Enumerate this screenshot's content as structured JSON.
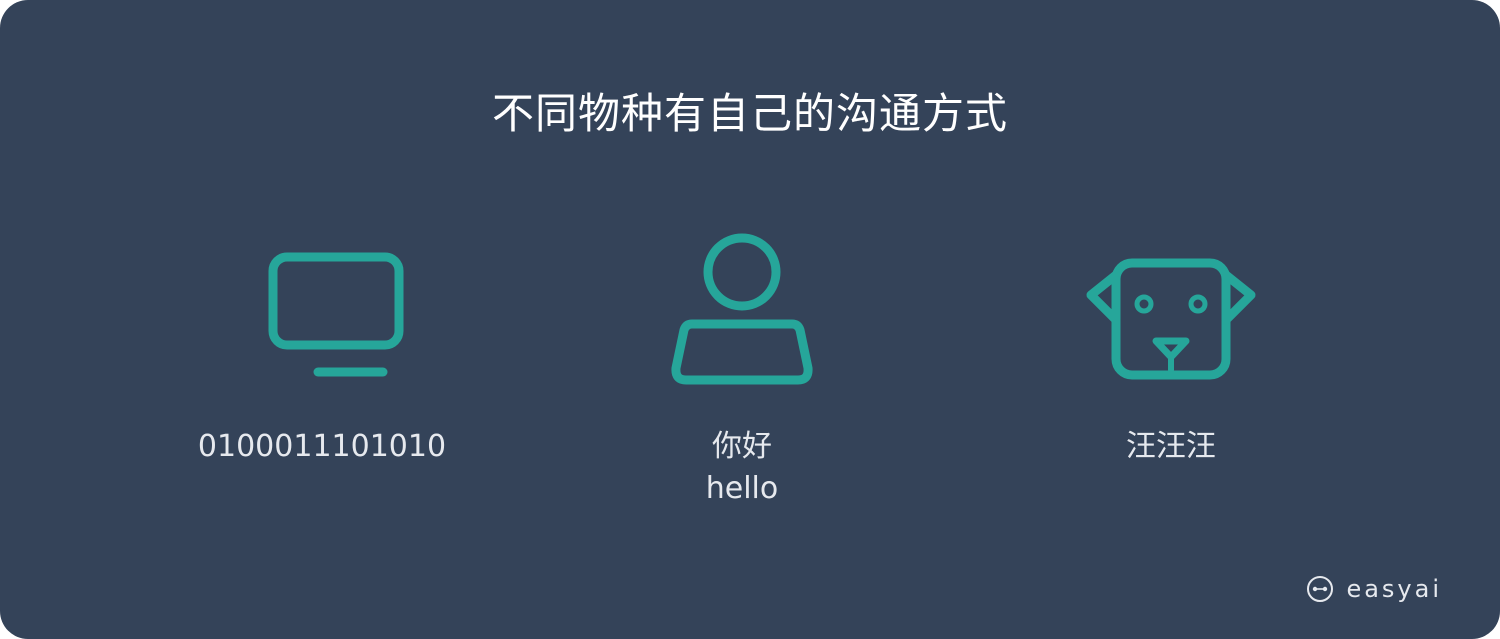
{
  "title": "不同物种有自己的沟通方式",
  "items": [
    {
      "icon": "computer-monitor-icon",
      "label": "0100011101010"
    },
    {
      "icon": "person-icon",
      "label": "你好",
      "sublabel": "hello"
    },
    {
      "icon": "dog-face-icon",
      "label": "汪汪汪"
    }
  ],
  "brand": {
    "icon": "easyai-logo-icon",
    "name": "easyai"
  },
  "colors": {
    "background": "#344359",
    "accent": "#26a69a",
    "text": "#ffffff",
    "muted": "#e6e9ee"
  }
}
